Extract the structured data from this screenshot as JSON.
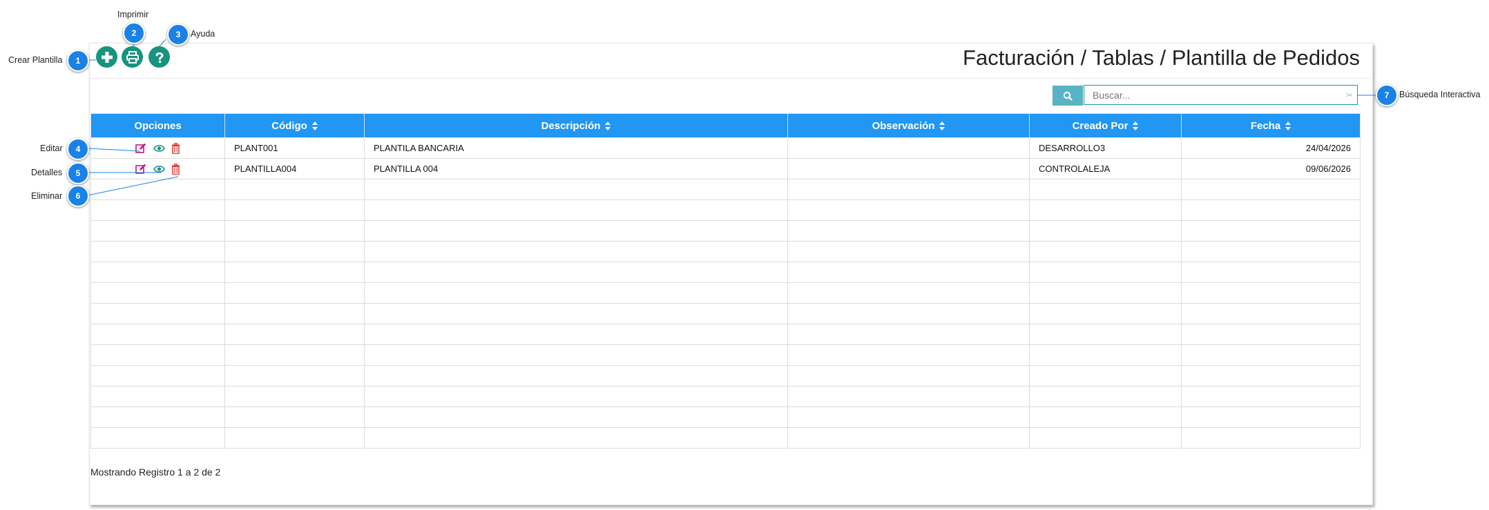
{
  "page": {
    "title": "Facturación / Tablas / Plantilla de Pedidos",
    "footer": "Mostrando Registro 1 a 2 de 2"
  },
  "toolbar": {
    "buttons": [
      {
        "name": "crear-plantilla-button",
        "icon": "plus-circle-icon"
      },
      {
        "name": "imprimir-button",
        "icon": "print-icon"
      },
      {
        "name": "ayuda-button",
        "icon": "question-icon"
      }
    ]
  },
  "search": {
    "placeholder": "Buscar...",
    "icon": "search-icon",
    "clear_glyph": "✂"
  },
  "table": {
    "columns": [
      "Opciones",
      "Código",
      "Descripción",
      "Observación",
      "Creado Por",
      "Fecha"
    ],
    "rows": [
      {
        "codigo": "PLANT001",
        "descripcion": "PLANTILA BANCARIA",
        "observacion": "",
        "creado_por": "DESARROLLO3",
        "fecha": "24/04/2026"
      },
      {
        "codigo": "PLANTILLA004",
        "descripcion": "PLANTILLA 004",
        "observacion": "",
        "creado_por": "CONTROLALEJA",
        "fecha": "09/06/2026"
      }
    ],
    "row_actions": [
      "edit-icon",
      "eye-icon",
      "trash-icon"
    ]
  },
  "annotations": [
    {
      "number": "1",
      "label": "Crear Plantilla"
    },
    {
      "number": "2",
      "label": "Imprimir"
    },
    {
      "number": "3",
      "label": "Ayuda"
    },
    {
      "number": "4",
      "label": "Editar"
    },
    {
      "number": "5",
      "label": "Detalles"
    },
    {
      "number": "6",
      "label": "Eliminar"
    },
    {
      "number": "7",
      "label": "Búsqueda Interactiva"
    }
  ],
  "colors": {
    "accent_green": "#16947e",
    "table_header": "#2196f3",
    "callout_blue": "#1a82e6",
    "edit_icon": "#c2187a",
    "view_icon": "#16947e",
    "delete_icon": "#e53935",
    "search_button": "#58b3c4"
  }
}
